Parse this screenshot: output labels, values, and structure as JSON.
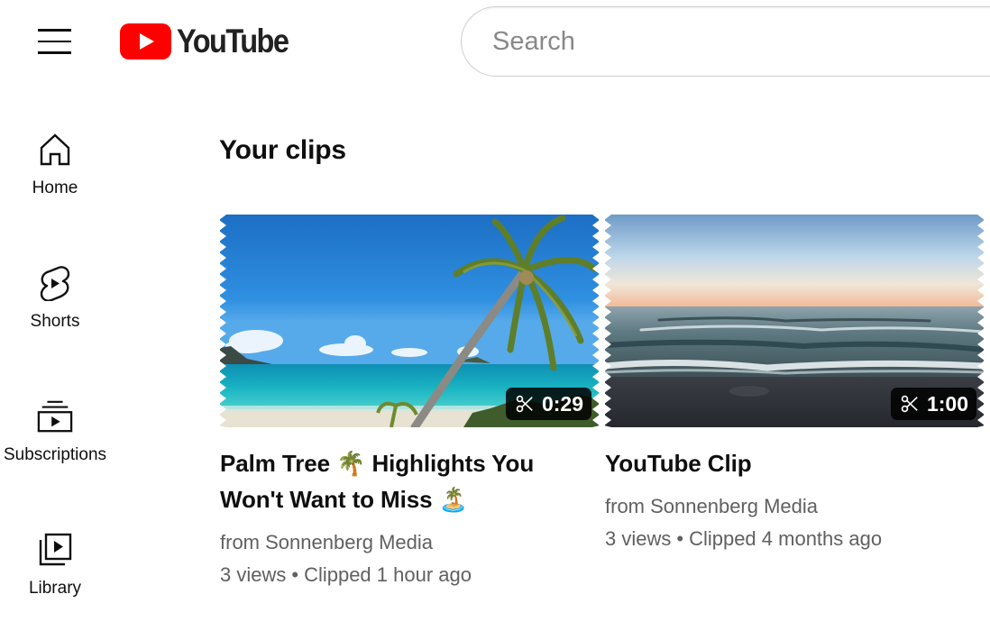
{
  "app": {
    "name": "YouTube"
  },
  "header": {
    "menu_icon": "hamburger-menu-icon",
    "logo_text": "YouTube",
    "logo_color": "#ff0000",
    "search": {
      "placeholder": "Search",
      "value": ""
    }
  },
  "sidebar": {
    "items": [
      {
        "label": "Home",
        "icon": "home-icon"
      },
      {
        "label": "Shorts",
        "icon": "shorts-icon"
      },
      {
        "label": "Subscriptions",
        "icon": "subscriptions-icon"
      },
      {
        "label": "Library",
        "icon": "library-icon"
      }
    ]
  },
  "main": {
    "title": "Your clips",
    "clips": [
      {
        "title": "Palm Tree 🌴 Highlights You Won't Want to Miss 🏝️",
        "duration": "0:29",
        "duration_icon": "scissors-icon",
        "channel": "from Sonnenberg Media",
        "views": "3 views",
        "separator": "•",
        "clipped": "Clipped 1 hour ago",
        "thumbnail": "tropical beach with leaning palm tree"
      },
      {
        "title": "YouTube Clip",
        "duration": "1:00",
        "duration_icon": "scissors-icon",
        "channel": "from Sonnenberg Media",
        "views": "3 views",
        "separator": "•",
        "clipped": "Clipped 4 months ago",
        "thumbnail": "ocean waves at dusk"
      }
    ]
  }
}
